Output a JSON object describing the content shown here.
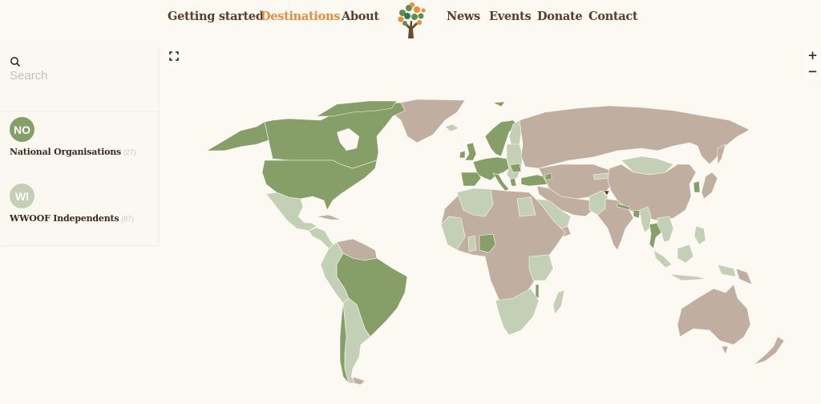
{
  "nav": {
    "left": [
      "Getting started",
      "Destinations",
      "About"
    ],
    "right": [
      "News",
      "Events",
      "Donate",
      "Contact"
    ],
    "active": "Destinations",
    "logo": "wwoof-tree-logo"
  },
  "search": {
    "placeholder": "Search",
    "value": ""
  },
  "legend": [
    {
      "abbr": "NO",
      "label": "National Organisations",
      "count": "(27)",
      "color": "#869f68"
    },
    {
      "abbr": "WI",
      "label": "WWOOF Independents",
      "count": "(87)",
      "color": "#c4d0b6"
    }
  ],
  "controls": {
    "fullscreen": "fullscreen-icon",
    "zoom_in": "+",
    "zoom_out": "−"
  },
  "colors": {
    "background": "#fcf9f3",
    "national_organisation": "#869f68",
    "independent": "#c4d0b6",
    "no_wwoof": "#c0aea0",
    "highlight": "#5a3d2b",
    "accent": "#ee8a3a",
    "nav_text": "#5a3d2b"
  },
  "map": {
    "national_organisations": [
      "United States",
      "Canada",
      "Brazil",
      "Chile",
      "United Kingdom",
      "Ireland",
      "France",
      "Spain",
      "Portugal",
      "Germany",
      "Italy",
      "Norway",
      "Sweden",
      "Denmark",
      "Switzerland",
      "Austria",
      "Czech Republic",
      "Romania",
      "Greece",
      "Turkey",
      "Nigeria",
      "Malawi",
      "Nepal",
      "Bangladesh",
      "Thailand",
      "South Korea",
      "Georgia"
    ],
    "independents": [
      "Mexico",
      "Central America",
      "Colombia",
      "Peru",
      "Bolivia",
      "Argentina",
      "Uruguay",
      "Ecuador",
      "Iceland",
      "Finland",
      "Poland",
      "Hungary",
      "Baltics",
      "Morocco",
      "Algeria",
      "Egypt",
      "Saudi Arabia",
      "Oman",
      "Pakistan",
      "Mongolia",
      "Myanmar",
      "Laos",
      "Cambodia",
      "Indonesia",
      "Malaysia",
      "Philippines",
      "Kenya",
      "Tanzania",
      "Zambia",
      "Mozambique",
      "Zimbabwe",
      "Namibia",
      "Botswana",
      "South Africa",
      "Madagascar",
      "Ghana",
      "Senegal",
      "Kyrgyzstan"
    ],
    "highlighted": "Kashmir"
  }
}
